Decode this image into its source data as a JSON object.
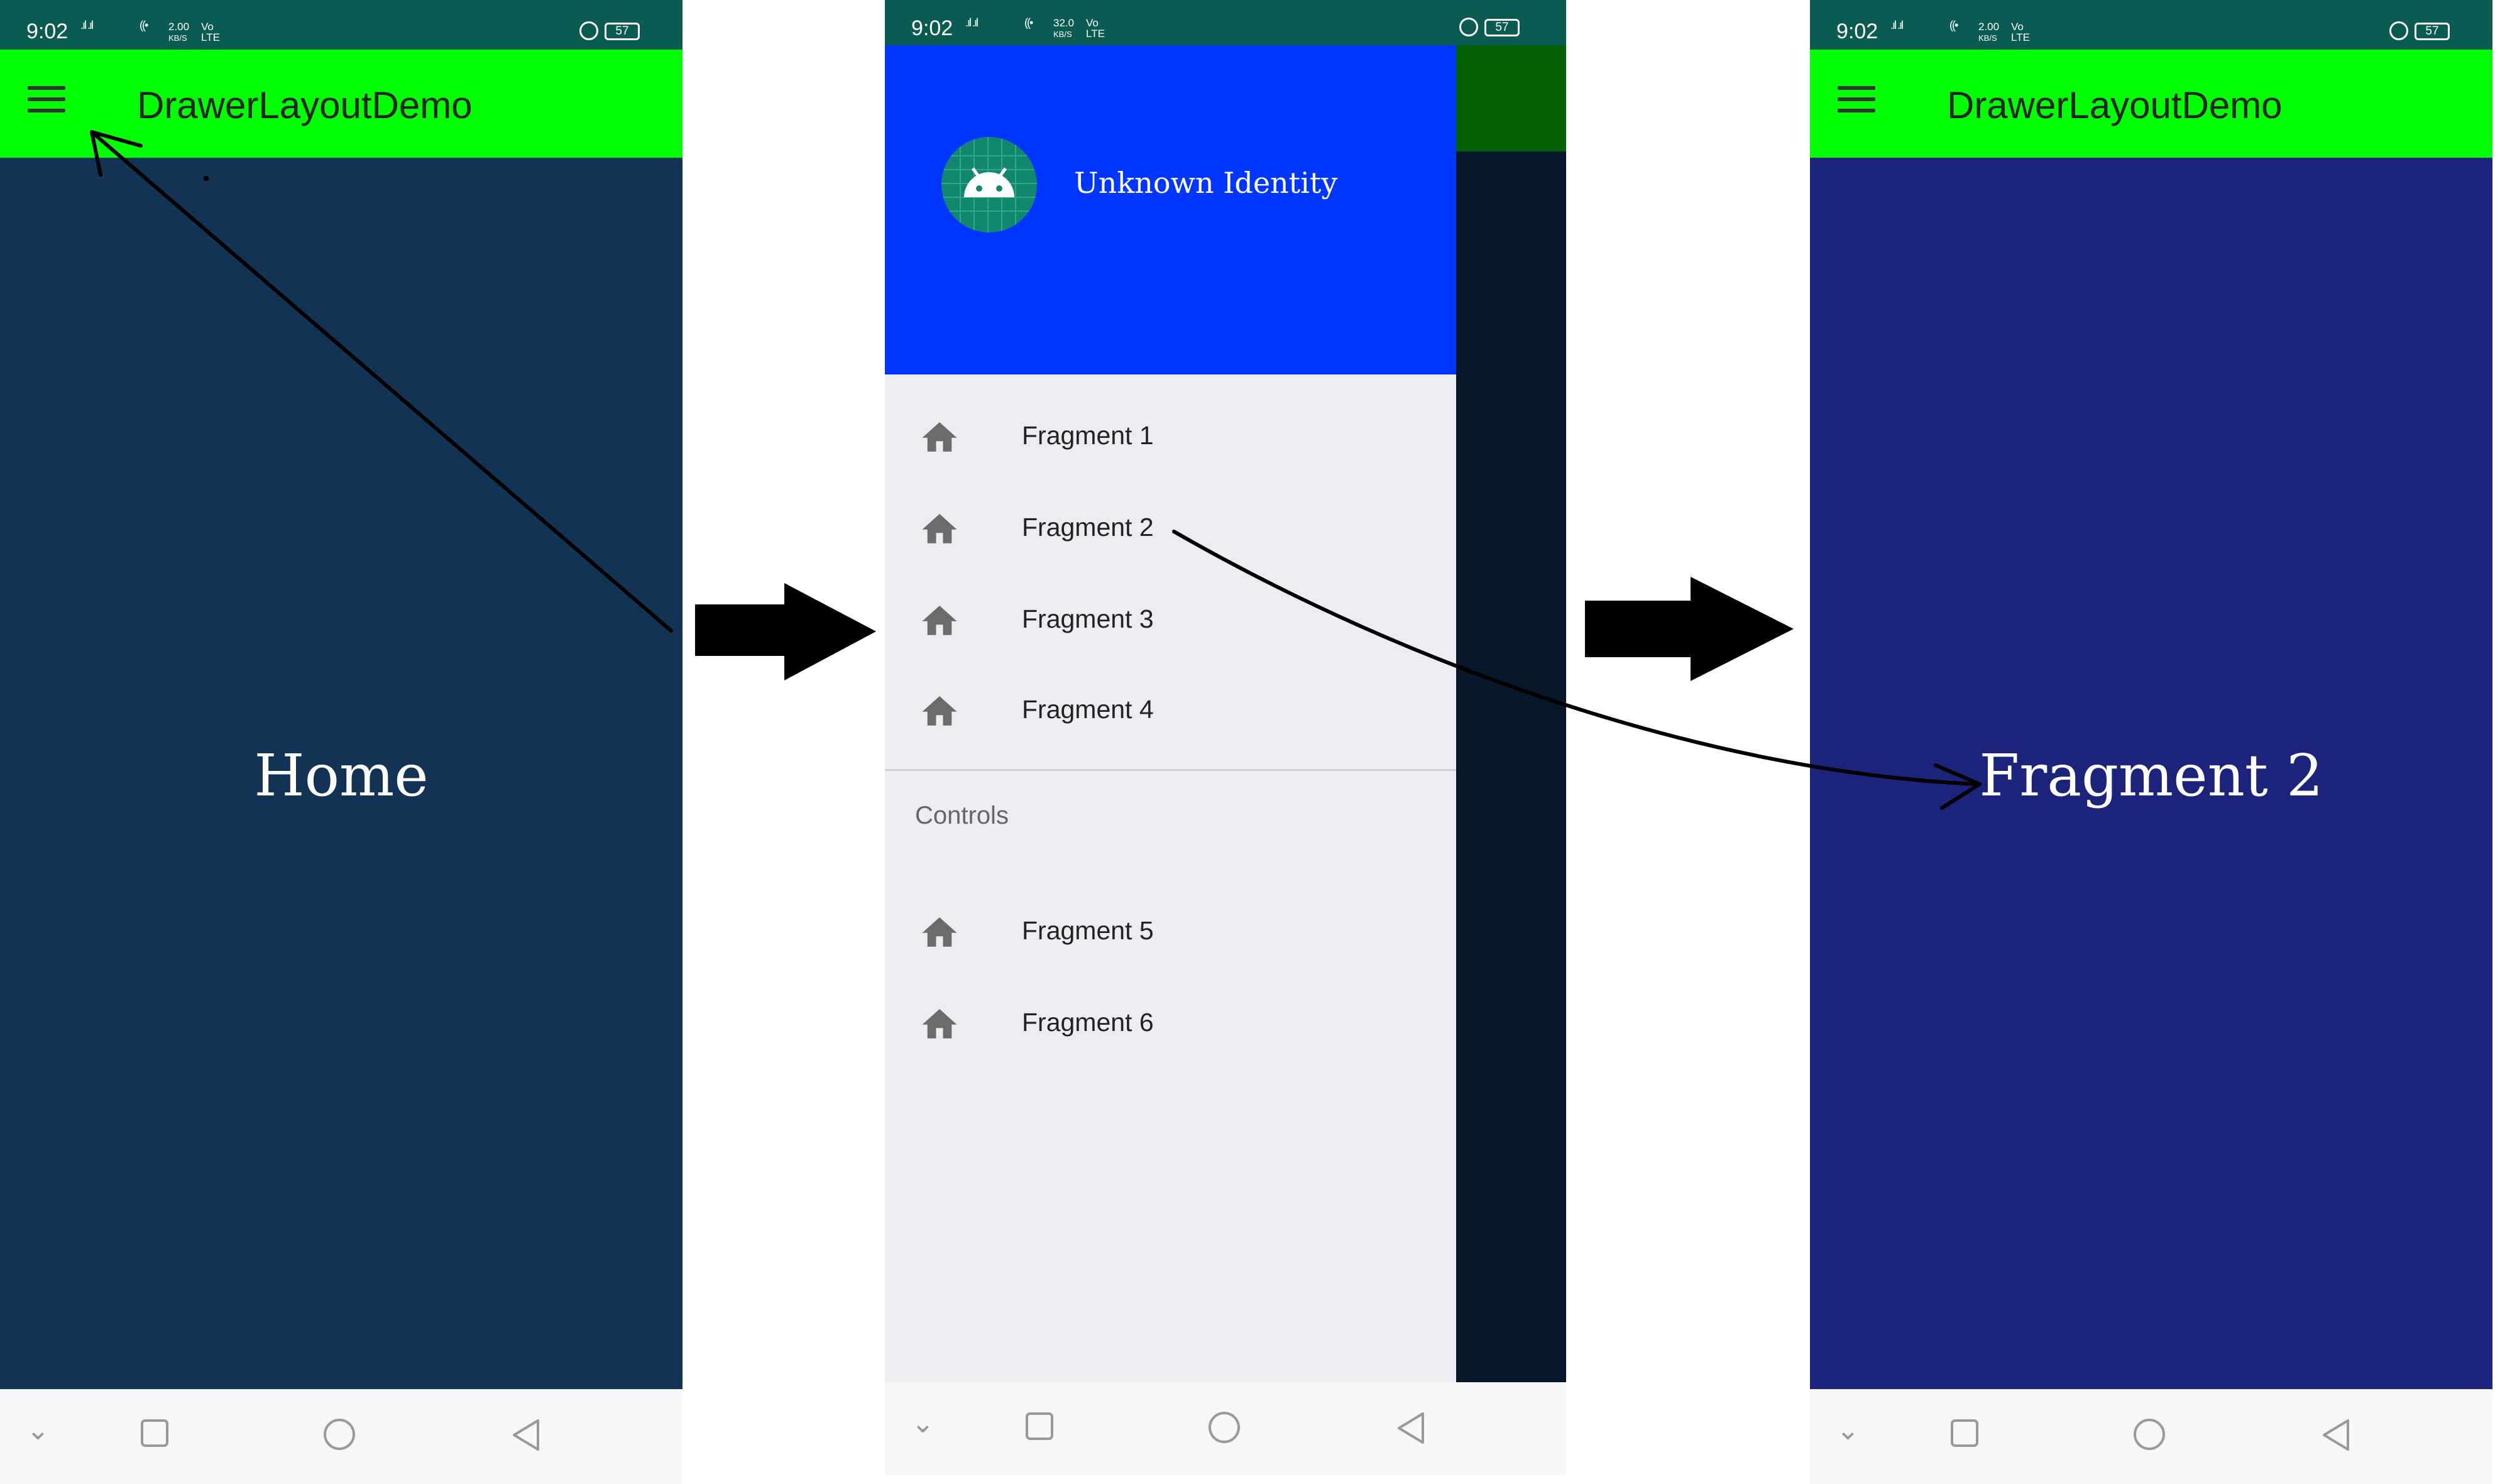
{
  "status": {
    "time": "9:02",
    "speed_left": "2.00",
    "speed_mid": "32.0",
    "speed_unit": "KB/S",
    "volte": "Vo",
    "lte": "LTE",
    "battery": "57"
  },
  "app": {
    "title": "DrawerLayoutDemo"
  },
  "screen1": {
    "content_text": "Home",
    "bg": "#133354"
  },
  "screen3": {
    "content_text": "Fragment 2",
    "bg": "#1b237b"
  },
  "drawer": {
    "header_name": "Unknown Identity",
    "items": [
      {
        "label": "Fragment 1"
      },
      {
        "label": "Fragment 2"
      },
      {
        "label": "Fragment 3"
      },
      {
        "label": "Fragment 4"
      }
    ],
    "section_title": "Controls",
    "section_items": [
      {
        "label": "Fragment 5"
      },
      {
        "label": "Fragment 6"
      }
    ],
    "scrim_bg": "#07172a",
    "header_bg": "#0036ff"
  },
  "colors": {
    "appbar": "#00ff00",
    "status": "#0a5c53"
  },
  "icons": [
    "menu-icon",
    "home-icon",
    "android-icon",
    "square-icon",
    "circle-icon",
    "triangle-back-icon",
    "chevron-down-icon"
  ]
}
